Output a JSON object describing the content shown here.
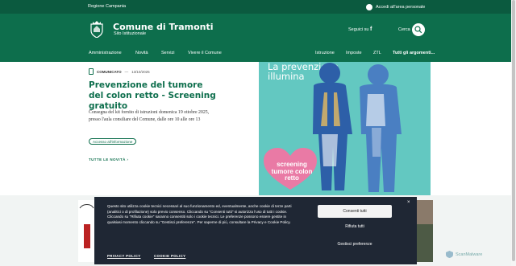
{
  "topbar": {
    "region": "Regione Campania",
    "login": "Accedi all'area personale"
  },
  "header": {
    "title": "Comune di Tramonti",
    "subtitle": "Sito Istituzionale",
    "follow": "Seguici su",
    "facebook_icon": "facebook-icon",
    "search_label": "Cerca"
  },
  "nav": {
    "left": [
      "Amministrazione",
      "Novità",
      "Servizi",
      "Vivere il Comune"
    ],
    "right": [
      "Istruzione",
      "Imposte",
      "ZTL",
      "Tutti gli argomenti..."
    ]
  },
  "news": {
    "category": "COMUNICATO",
    "separator": "—",
    "date": "13/10/2025",
    "headline": "Prevenzione del tumore del colon retto - Screening gratuito",
    "summary": "Consegna del kit fornito di istruzioni domenica 19 ottobre 2025, presso l'aula consiliare del Comune, dalle ore 10 alle ore 13",
    "tag": "Accesso all'informazione",
    "all_news": "TUTTE LE NOVITÀ"
  },
  "poster": {
    "title": "La prevenzione illumina",
    "heart_text": "screening tumore colon retto"
  },
  "cookie": {
    "text": "Questo sito utilizza cookie tecnici necessari al suo funzionamento ed, eventualmente, anche cookie di terze parti (analitici o di profilazione) solo previo consenso. Cliccando su \"Consenti tutti\" si autorizza l'uso di tutti i cookie. Cliccando su \"Rifiuta cookie\" saranno consentiti solo i cookie tecnici. Le preferenze possono essere gestite in qualsiasi momento cliccando su \"Gestisci preferenze\". Per saperne di più, consultare la Privacy e Cookie Policy.",
    "accept": "Consenti tutti",
    "reject": "Rifiuta tutti",
    "prefs": "Gestisci preferenze",
    "privacy": "PRIVACY POLICY",
    "cookie_policy": "COOKIE POLICY",
    "close": "×"
  },
  "watermark": "ScanMalware",
  "colors": {
    "primary": "#0d6e4c",
    "dark_top": "#0b5a3f",
    "banner": "#1f2734",
    "poster": "#63c8c1",
    "pink": "#e97aa5"
  }
}
